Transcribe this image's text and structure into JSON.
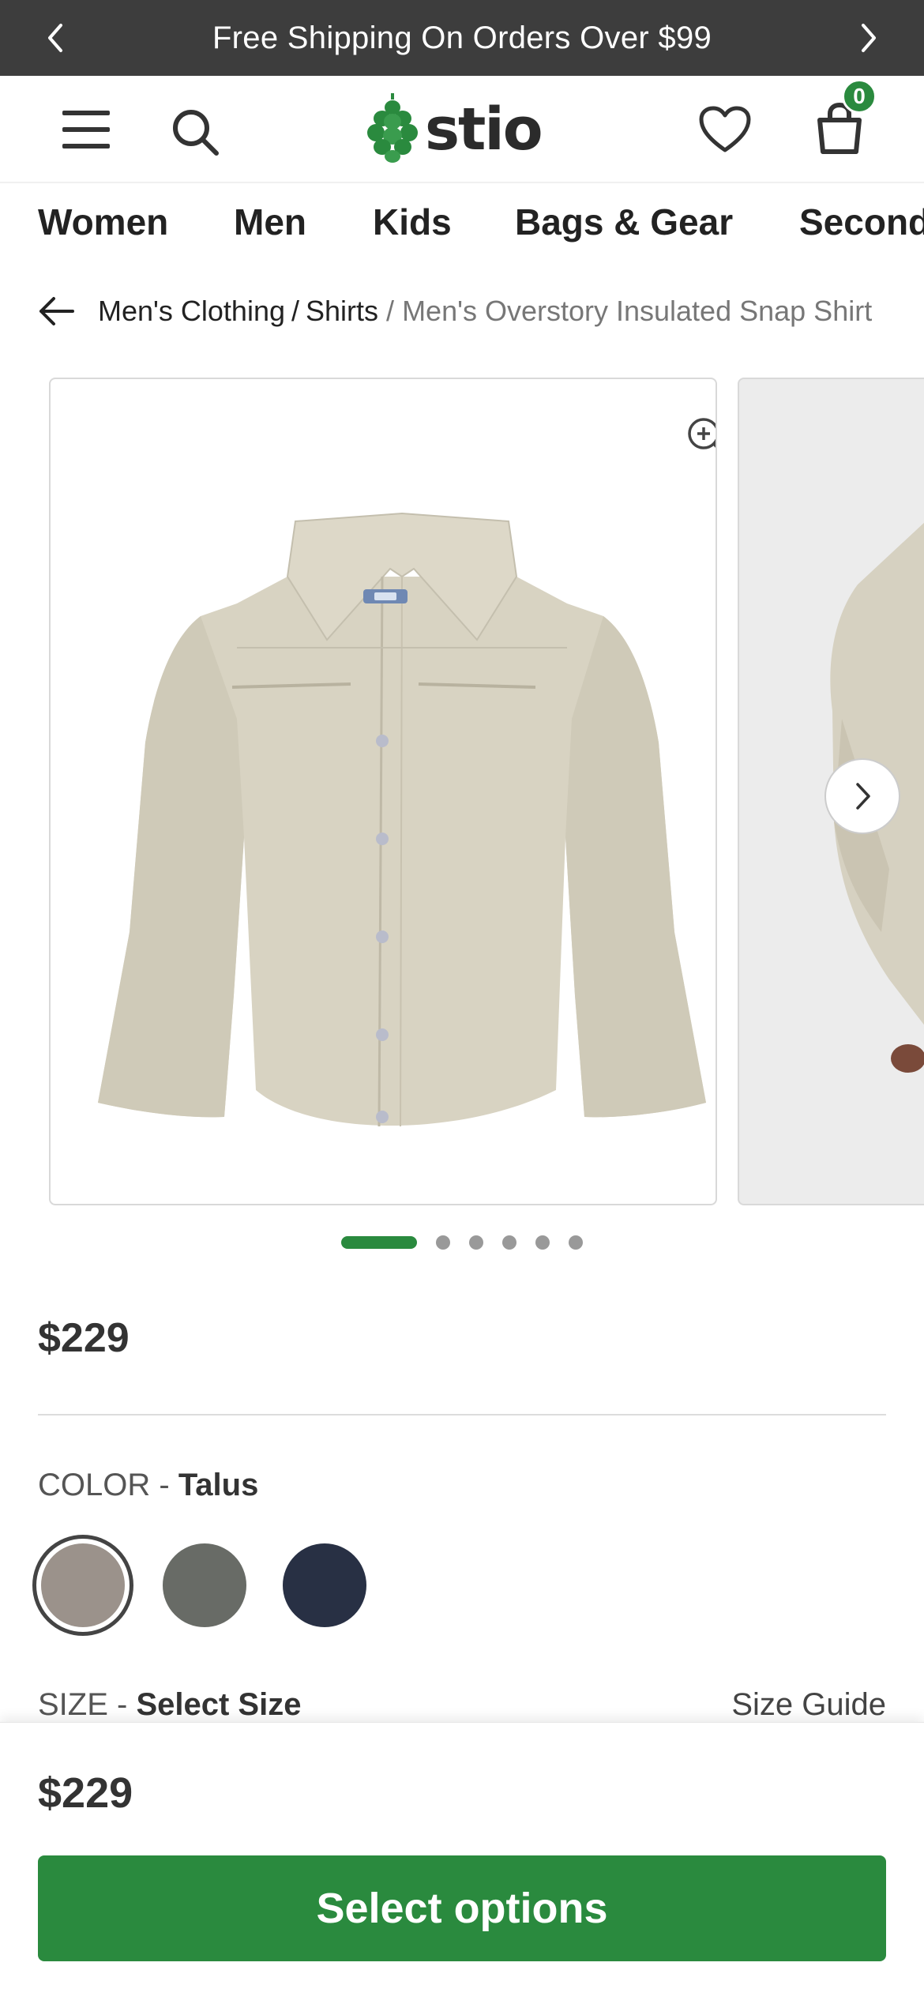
{
  "promo": {
    "text": "Free Shipping On Orders Over $99",
    "prev_icon": "chevron-left-icon",
    "next_icon": "chevron-right-icon"
  },
  "header": {
    "menu_icon": "hamburger-menu-icon",
    "search_icon": "search-icon",
    "logo_text": "stio",
    "logo_icon": "pinecone-icon",
    "wishlist_icon": "heart-icon",
    "cart_icon": "shopping-bag-icon",
    "cart_count": "0"
  },
  "nav": {
    "categories": [
      "Women",
      "Men",
      "Kids",
      "Bags & Gear",
      "Second"
    ]
  },
  "breadcrumb": {
    "back_icon": "arrow-left-icon",
    "items": [
      "Men's Clothing",
      "Shirts",
      "Men's Overstory Insulated Snap Shirt"
    ]
  },
  "gallery": {
    "zoom_icon": "zoom-in-icon",
    "next_icon": "chevron-right-icon",
    "total_images": 6,
    "active_index": 0
  },
  "product": {
    "price": "$229",
    "color_label": "COLOR -",
    "color_value": "Talus",
    "swatches": [
      {
        "name": "Talus",
        "hex": "#9b928b",
        "selected": true
      },
      {
        "name": "Gray",
        "hex": "#686b66",
        "selected": false
      },
      {
        "name": "Navy",
        "hex": "#283044",
        "selected": false
      }
    ],
    "size_label": "SIZE -",
    "size_value": "Select Size",
    "size_guide": "Size Guide"
  },
  "sticky": {
    "price": "$229",
    "cta_label": "Select options"
  },
  "colors": {
    "accent": "#2a8a3e",
    "promo_bg": "#3d3d3d"
  }
}
